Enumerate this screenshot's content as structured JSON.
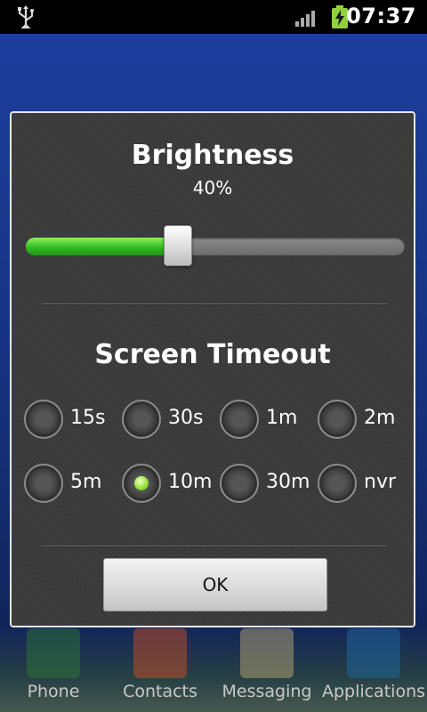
{
  "statusbar": {
    "time": "07:37"
  },
  "brightness": {
    "title": "Brightness",
    "percent_label": "40%",
    "level": 0.4
  },
  "timeout": {
    "title": "Screen Timeout",
    "options": [
      {
        "label": "15s",
        "selected": false
      },
      {
        "label": "30s",
        "selected": false
      },
      {
        "label": "1m",
        "selected": false
      },
      {
        "label": "2m",
        "selected": false
      },
      {
        "label": "5m",
        "selected": false
      },
      {
        "label": "10m",
        "selected": true
      },
      {
        "label": "30m",
        "selected": false
      },
      {
        "label": "nvr",
        "selected": false
      }
    ]
  },
  "ok_label": "OK",
  "dock": {
    "items": [
      {
        "label": "Phone",
        "icon": "phone-icon",
        "color": "#2e7d32"
      },
      {
        "label": "Contacts",
        "icon": "contacts-icon",
        "color": "#d9531e"
      },
      {
        "label": "Messaging",
        "icon": "messaging-icon",
        "color": "#c9b27a"
      },
      {
        "label": "Applications",
        "icon": "grid-icon",
        "color": "#1f6fa8"
      }
    ]
  },
  "colors": {
    "accent_green": "#2fb81f",
    "dialog_bg": "#3a3a3a"
  }
}
